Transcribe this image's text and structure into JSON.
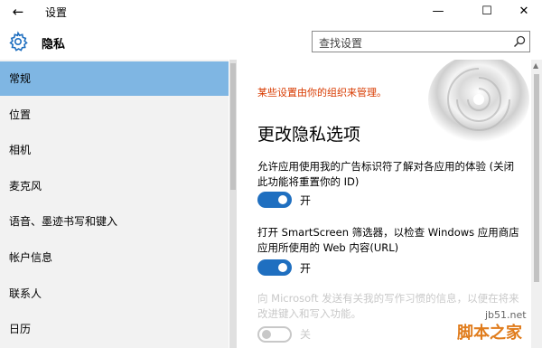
{
  "window": {
    "title": "设置",
    "back_glyph": "←",
    "min_glyph": "—",
    "max_glyph": "☐",
    "close_glyph": "✕"
  },
  "header": {
    "title": "隐私",
    "search_placeholder": "查找设置"
  },
  "sidebar": {
    "items": [
      {
        "label": "常规",
        "active": true
      },
      {
        "label": "位置"
      },
      {
        "label": "相机"
      },
      {
        "label": "麦克风"
      },
      {
        "label": "语音、墨迹书写和键入"
      },
      {
        "label": "帐户信息"
      },
      {
        "label": "联系人"
      },
      {
        "label": "日历"
      }
    ]
  },
  "content": {
    "org_note": "某些设置由你的组织来管理。",
    "section_title": "更改隐私选项",
    "settings": [
      {
        "desc": "允许应用使用我的广告标识符了解对各应用的体验 (关闭此功能将重置你的 ID)",
        "state": "开",
        "on": true
      },
      {
        "desc": "打开 SmartScreen 筛选器，以检查 Windows 应用商店应用所使用的 Web 内容(URL)",
        "state": "开",
        "on": true
      },
      {
        "desc": "向 Microsoft 发送有关我的写作习惯的信息，以便在将来改进键入和写入功能。",
        "state": "关",
        "on": false
      }
    ]
  },
  "watermark": {
    "url": "jb51.net",
    "name": "脚本之家"
  },
  "colors": {
    "accent": "#1f6fc0",
    "sidebar_active": "#7fb6e3",
    "warning": "#d83b01"
  },
  "icons": [
    "back-arrow-icon",
    "settings-gear-icon",
    "search-icon",
    "minimize-icon",
    "maximize-icon",
    "close-icon"
  ]
}
